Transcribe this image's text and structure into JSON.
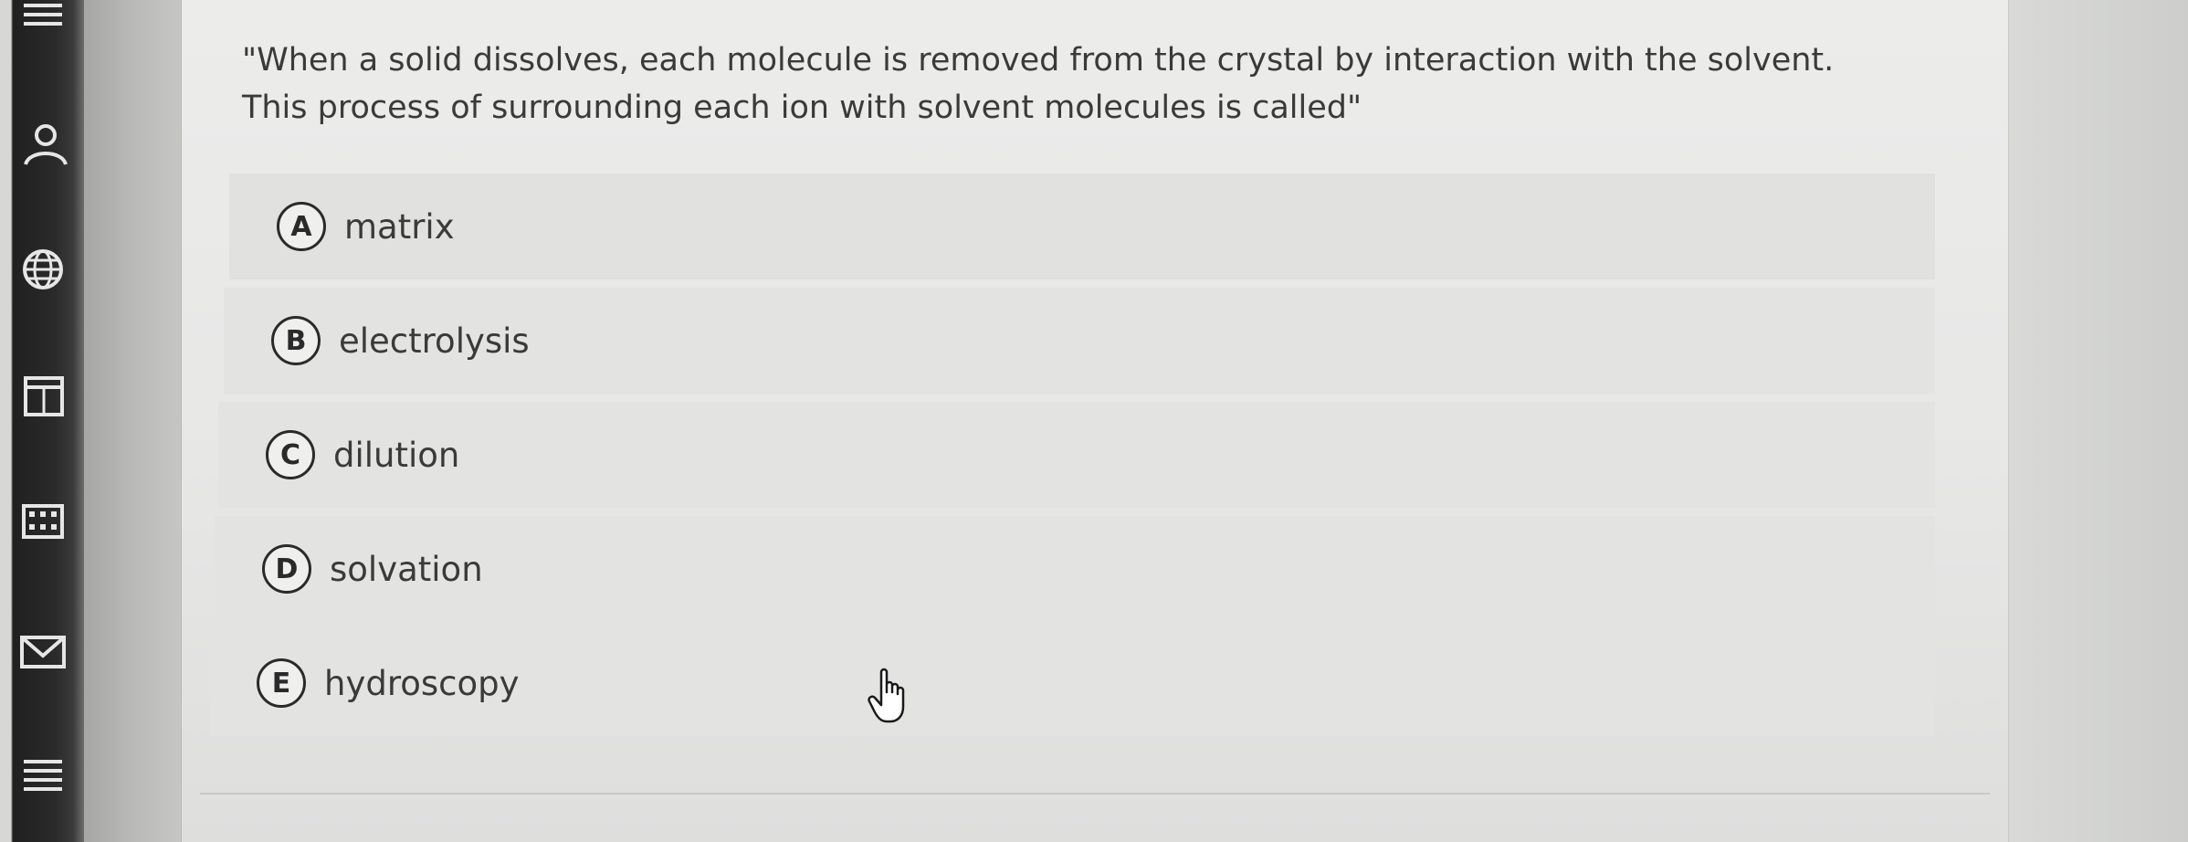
{
  "question": {
    "text": "\"When a solid dissolves, each molecule is removed from the crystal by interaction with the solvent. This process of surrounding each ion with solvent molecules is called\""
  },
  "options": [
    {
      "letter": "A",
      "label": "matrix"
    },
    {
      "letter": "B",
      "label": "electrolysis"
    },
    {
      "letter": "C",
      "label": "dilution"
    },
    {
      "letter": "D",
      "label": "solvation"
    },
    {
      "letter": "E",
      "label": "hydroscopy"
    }
  ],
  "sidebar": {
    "icons": [
      "list-icon",
      "user-icon",
      "globe-icon",
      "calendar-icon",
      "grid-icon",
      "mail-icon",
      "menu-icon"
    ]
  },
  "colors": {
    "panel": "#ececeb",
    "text": "#3a3a3a",
    "circle_border": "#2a2a2a"
  }
}
